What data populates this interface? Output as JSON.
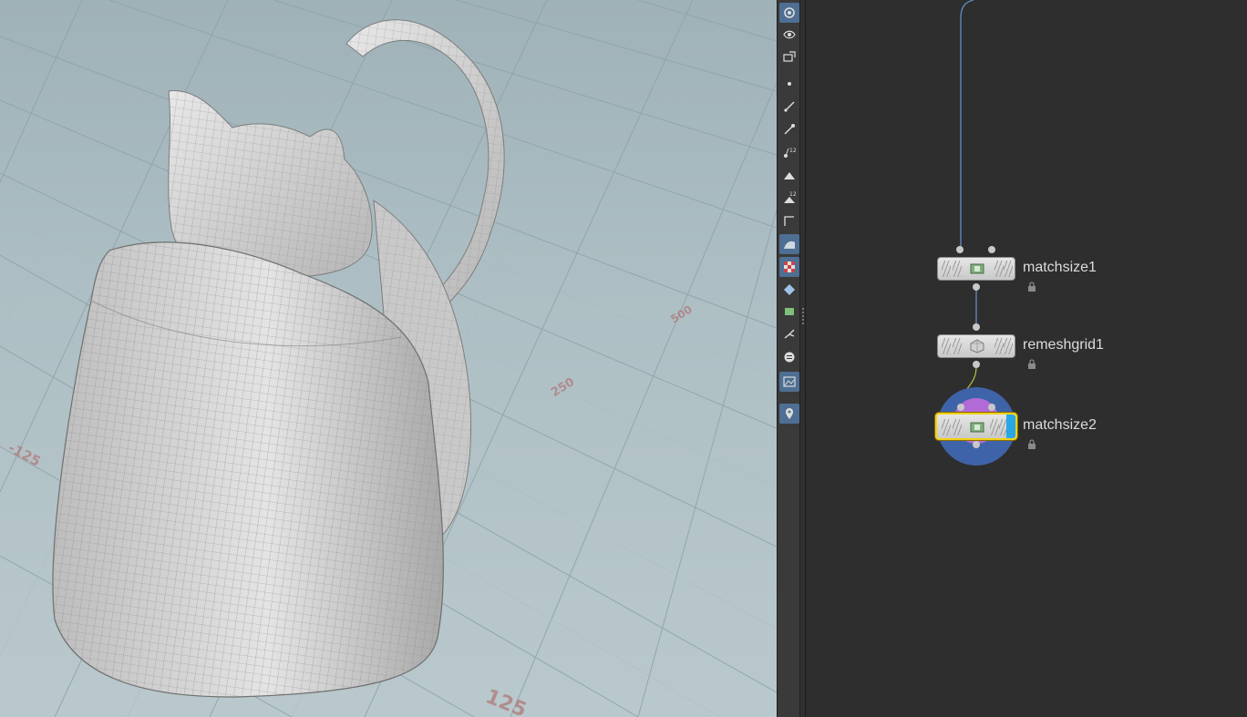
{
  "viewport": {
    "grid_labels": [
      "-125",
      "250",
      "500",
      "125"
    ]
  },
  "toolbar": {
    "tools": [
      {
        "name": "view-tool-icon",
        "active": true
      },
      {
        "name": "select-tool-icon",
        "active": false
      },
      {
        "name": "handle-tool-icon",
        "active": false
      },
      {
        "name": "point-icon",
        "active": false
      },
      {
        "name": "edge-icon",
        "active": false
      },
      {
        "name": "pin-icon",
        "active": false
      },
      {
        "name": "point-numbers-icon",
        "active": false
      },
      {
        "name": "primitive-icon",
        "active": false
      },
      {
        "name": "primitive-numbers-icon",
        "active": false
      },
      {
        "name": "normals-icon",
        "active": false
      },
      {
        "name": "wireframe-shaded-icon",
        "active": true
      },
      {
        "name": "texture-icon",
        "active": true
      },
      {
        "name": "ghost-icon",
        "active": false
      },
      {
        "name": "template-icon",
        "active": false
      },
      {
        "name": "snap-icon",
        "active": false
      },
      {
        "name": "display-options-icon",
        "active": false
      },
      {
        "name": "background-image-icon",
        "active": true
      },
      {
        "name": "location-pin-icon",
        "active": true
      }
    ]
  },
  "network": {
    "nodes": [
      {
        "label": "matchsize1"
      },
      {
        "label": "remeshgrid1"
      },
      {
        "label": "matchsize2"
      }
    ]
  },
  "colors": {
    "selection": "#f2d21a",
    "display_flag": "#27a7e6",
    "wire": "#5d88b8",
    "halo_outer": "#3f63a8",
    "halo_inner": "#b26bd6"
  }
}
